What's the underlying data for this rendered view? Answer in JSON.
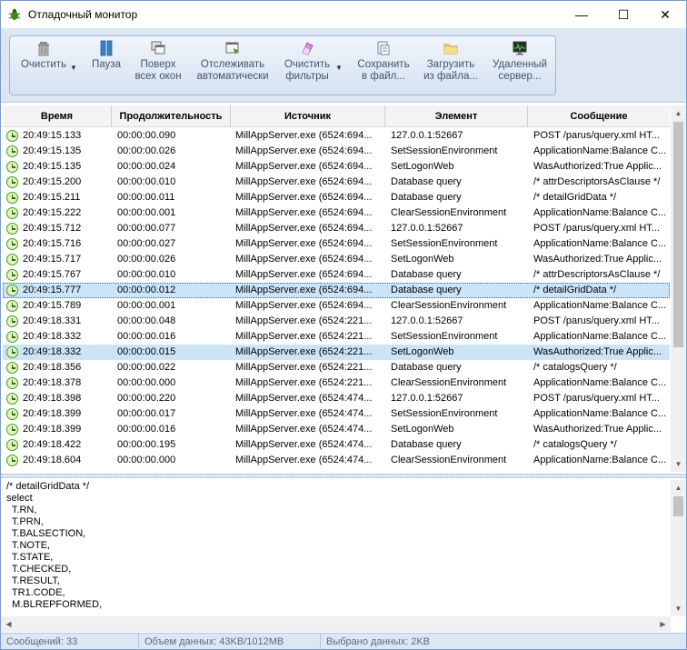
{
  "window": {
    "title": "Отладочный монитор",
    "minimize_glyph": "—",
    "maximize_glyph": "☐",
    "close_glyph": "✕"
  },
  "toolbar": {
    "clear": {
      "line1": "Очистить",
      "line2": "",
      "icon": "trash-icon"
    },
    "pause": {
      "line1": "Пауза",
      "line2": "",
      "icon": "pause-icon"
    },
    "topmost": {
      "line1": "Поверх",
      "line2": "всех окон",
      "icon": "windows-stack-icon"
    },
    "autotrack": {
      "line1": "Отслеживать",
      "line2": "автоматически",
      "icon": "window-arrow-icon"
    },
    "clear_filters": {
      "line1": "Очистить",
      "line2": "фильтры",
      "icon": "eraser-icon"
    },
    "save": {
      "line1": "Сохранить",
      "line2": "в файл...",
      "icon": "save-file-icon"
    },
    "load": {
      "line1": "Загрузить",
      "line2": "из файла...",
      "icon": "folder-icon"
    },
    "remote": {
      "line1": "Удаленный",
      "line2": "сервер...",
      "icon": "monitor-graph-icon"
    }
  },
  "grid": {
    "columns": [
      "Время",
      "Продолжительность",
      "Источник",
      "Элемент",
      "Сообщение"
    ],
    "rows": [
      {
        "time": "20:49:15.133",
        "duration": "00:00:00.090",
        "source": "MillAppServer.exe (6524:694...",
        "element": "127.0.0.1:52667",
        "message": "POST /parus/query.xml HT..."
      },
      {
        "time": "20:49:15.135",
        "duration": "00:00:00.026",
        "source": "MillAppServer.exe (6524:694...",
        "element": "SetSessionEnvironment",
        "message": "ApplicationName:Balance C..."
      },
      {
        "time": "20:49:15.135",
        "duration": "00:00:00.024",
        "source": "MillAppServer.exe (6524:694...",
        "element": "SetLogonWeb",
        "message": "WasAuthorized:True Applic..."
      },
      {
        "time": "20:49:15.200",
        "duration": "00:00:00.010",
        "source": "MillAppServer.exe (6524:694...",
        "element": "Database query",
        "message": "/* attrDescriptorsAsClause */"
      },
      {
        "time": "20:49:15.211",
        "duration": "00:00:00.011",
        "source": "MillAppServer.exe (6524:694...",
        "element": "Database query",
        "message": "/* detailGridData */"
      },
      {
        "time": "20:49:15.222",
        "duration": "00:00:00.001",
        "source": "MillAppServer.exe (6524:694...",
        "element": "ClearSessionEnvironment",
        "message": "ApplicationName:Balance C..."
      },
      {
        "time": "20:49:15.712",
        "duration": "00:00:00.077",
        "source": "MillAppServer.exe (6524:694...",
        "element": "127.0.0.1:52667",
        "message": "POST /parus/query.xml HT..."
      },
      {
        "time": "20:49:15.716",
        "duration": "00:00:00.027",
        "source": "MillAppServer.exe (6524:694...",
        "element": "SetSessionEnvironment",
        "message": "ApplicationName:Balance C..."
      },
      {
        "time": "20:49:15.717",
        "duration": "00:00:00.026",
        "source": "MillAppServer.exe (6524:694...",
        "element": "SetLogonWeb",
        "message": "WasAuthorized:True Applic..."
      },
      {
        "time": "20:49:15.767",
        "duration": "00:00:00.010",
        "source": "MillAppServer.exe (6524:694...",
        "element": "Database query",
        "message": "/* attrDescriptorsAsClause */"
      },
      {
        "time": "20:49:15.777",
        "duration": "00:00:00.012",
        "source": "MillAppServer.exe (6524:694...",
        "element": "Database query",
        "message": "/* detailGridData */",
        "state": "focus"
      },
      {
        "time": "20:49:15.789",
        "duration": "00:00:00.001",
        "source": "MillAppServer.exe (6524:694...",
        "element": "ClearSessionEnvironment",
        "message": "ApplicationName:Balance C..."
      },
      {
        "time": "20:49:18.331",
        "duration": "00:00:00.048",
        "source": "MillAppServer.exe (6524:221...",
        "element": "127.0.0.1:52667",
        "message": "POST /parus/query.xml HT..."
      },
      {
        "time": "20:49:18.332",
        "duration": "00:00:00.016",
        "source": "MillAppServer.exe (6524:221...",
        "element": "SetSessionEnvironment",
        "message": "ApplicationName:Balance C..."
      },
      {
        "time": "20:49:18.332",
        "duration": "00:00:00.015",
        "source": "MillAppServer.exe (6524:221...",
        "element": "SetLogonWeb",
        "message": "WasAuthorized:True Applic...",
        "state": "sel"
      },
      {
        "time": "20:49:18.356",
        "duration": "00:00:00.022",
        "source": "MillAppServer.exe (6524:221...",
        "element": "Database query",
        "message": "/* catalogsQuery */"
      },
      {
        "time": "20:49:18.378",
        "duration": "00:00:00.000",
        "source": "MillAppServer.exe (6524:221...",
        "element": "ClearSessionEnvironment",
        "message": "ApplicationName:Balance C..."
      },
      {
        "time": "20:49:18.398",
        "duration": "00:00:00.220",
        "source": "MillAppServer.exe (6524:474...",
        "element": "127.0.0.1:52667",
        "message": "POST /parus/query.xml HT..."
      },
      {
        "time": "20:49:18.399",
        "duration": "00:00:00.017",
        "source": "MillAppServer.exe (6524:474...",
        "element": "SetSessionEnvironment",
        "message": "ApplicationName:Balance C..."
      },
      {
        "time": "20:49:18.399",
        "duration": "00:00:00.016",
        "source": "MillAppServer.exe (6524:474...",
        "element": "SetLogonWeb",
        "message": "WasAuthorized:True Applic..."
      },
      {
        "time": "20:49:18.422",
        "duration": "00:00:00.195",
        "source": "MillAppServer.exe (6524:474...",
        "element": "Database query",
        "message": "/* catalogsQuery */"
      },
      {
        "time": "20:49:18.604",
        "duration": "00:00:00.000",
        "source": "MillAppServer.exe (6524:474...",
        "element": "ClearSessionEnvironment",
        "message": "ApplicationName:Balance C..."
      }
    ]
  },
  "detail": {
    "text": "/* detailGridData */\nselect\n  T.RN,\n  T.PRN,\n  T.BALSECTION,\n  T.NOTE,\n  T.STATE,\n  T.CHECKED,\n  T.RESULT,\n  TR1.CODE,\n  M.BLREPFORMED,"
  },
  "status": {
    "messages": "Сообщений: 33",
    "data_volume": "Объем данных: 43KB/1012MB",
    "selected": "Выбрано данных: 2KB"
  }
}
